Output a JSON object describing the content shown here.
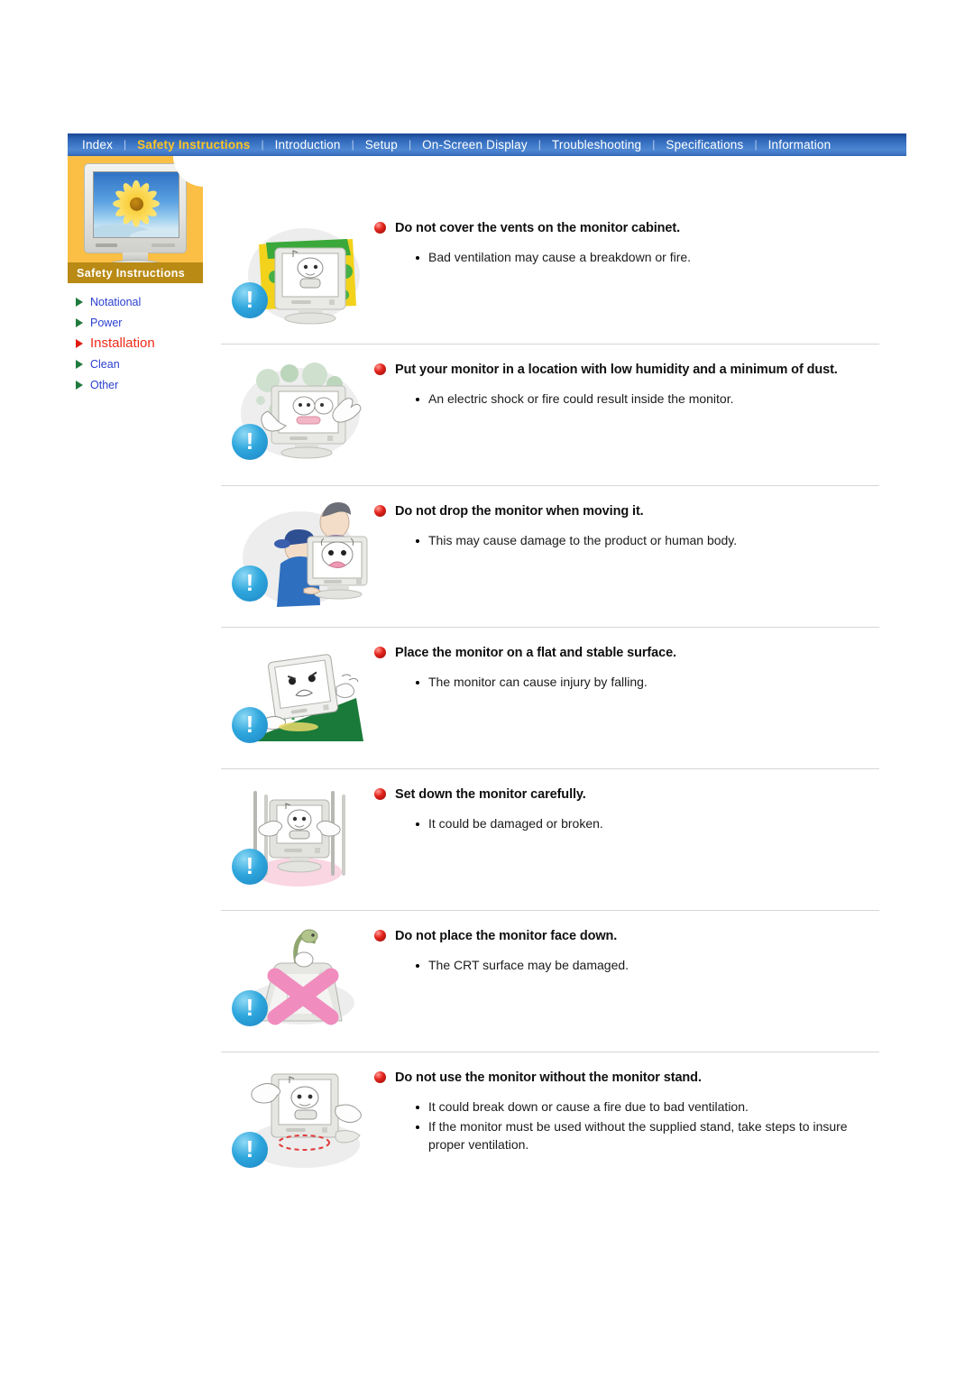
{
  "nav": {
    "separator": "|",
    "items": [
      {
        "label": "Index",
        "active": false
      },
      {
        "label": "Safety Instructions",
        "active": true
      },
      {
        "label": "Introduction",
        "active": false
      },
      {
        "label": "Setup",
        "active": false
      },
      {
        "label": "On-Screen Display",
        "active": false
      },
      {
        "label": "Troubleshooting",
        "active": false
      },
      {
        "label": "Specifications",
        "active": false
      },
      {
        "label": "Information",
        "active": false
      }
    ]
  },
  "sidebar": {
    "caption": "Safety Instructions",
    "thumbnail_icon": "monitor-sunflower-image",
    "items": [
      {
        "label": "Notational",
        "active": false
      },
      {
        "label": "Power",
        "active": false
      },
      {
        "label": "Installation",
        "active": true
      },
      {
        "label": "Clean",
        "active": false
      },
      {
        "label": "Other",
        "active": false
      }
    ]
  },
  "colors": {
    "nav_background": "#3a74c4",
    "nav_active_text": "#ffc423",
    "sidebar_panel": "#fbbf45",
    "sidebar_caption_bar": "#b98a14",
    "link": "#2a3fd0",
    "link_active": "#ef2b18",
    "bullet_triangle": "#1f7a3d",
    "bullet_triangle_active": "#e01b12",
    "heading_dot": "#e3231b",
    "warning_badge": "#2fa7dd",
    "divider": "#d6d6d6"
  },
  "sections": [
    {
      "illustration": "monitor-covered-with-cloth-illustration",
      "badge": "!",
      "heading": "Do not cover the vents on the monitor cabinet.",
      "items": [
        "Bad ventilation may cause a breakdown or fire."
      ]
    },
    {
      "illustration": "monitor-in-dusty-humid-room-illustration",
      "badge": "!",
      "heading": "Put your monitor in a location with low humidity and a minimum of dust.",
      "items": [
        "An electric shock or fire could result inside the monitor."
      ]
    },
    {
      "illustration": "two-people-carrying-monitor-illustration",
      "badge": "!",
      "heading": "Do not drop the monitor when moving it.",
      "items": [
        "This may cause damage to the product or human body."
      ]
    },
    {
      "illustration": "monitor-on-sloped-surface-illustration",
      "badge": "!",
      "heading": "Place the monitor on a flat and stable surface.",
      "items": [
        "The monitor can cause injury by falling."
      ]
    },
    {
      "illustration": "hands-setting-monitor-down-illustration",
      "badge": "!",
      "heading": "Set down the monitor carefully.",
      "items": [
        "It could be damaged or broken."
      ]
    },
    {
      "illustration": "monitor-face-down-crossed-out-illustration",
      "badge": "!",
      "heading": "Do not place the monitor face down.",
      "items": [
        "The CRT surface may be damaged."
      ]
    },
    {
      "illustration": "monitor-without-stand-illustration",
      "badge": "!",
      "heading": "Do not use the monitor without the monitor stand.",
      "items": [
        "It could break down or cause a fire due to bad ventilation.",
        "If the monitor must be used without the supplied stand, take steps to insure proper ventilation."
      ]
    }
  ]
}
